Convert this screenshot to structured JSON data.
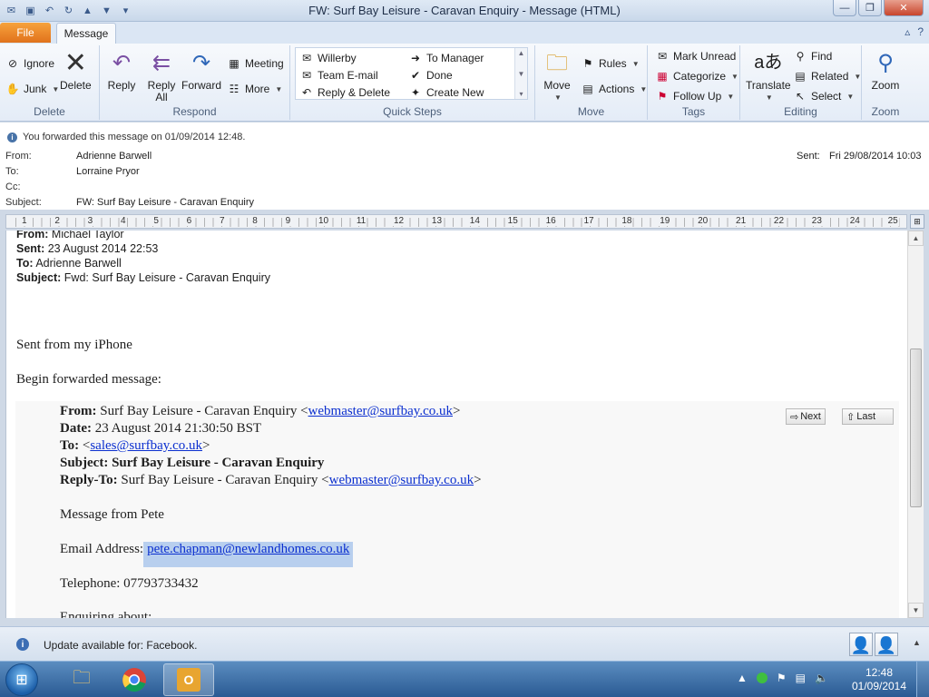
{
  "window": {
    "title": "FW: Surf Bay Leisure - Caravan Enquiry  -  Message (HTML)"
  },
  "tabs": {
    "file": "File",
    "message": "Message"
  },
  "ribbon": {
    "delete_group": {
      "ignore": "Ignore",
      "junk": "Junk",
      "delete": "Delete",
      "label": "Delete"
    },
    "respond_group": {
      "reply": "Reply",
      "reply_all_1": "Reply",
      "reply_all_2": "All",
      "forward": "Forward",
      "meeting": "Meeting",
      "more": "More",
      "label": "Respond"
    },
    "quick_steps": {
      "items": [
        "Willerby",
        "To Manager",
        "Team E-mail",
        "Done",
        "Reply & Delete",
        "Create New"
      ],
      "label": "Quick Steps"
    },
    "move_group": {
      "move": "Move",
      "rules": "Rules",
      "actions": "Actions",
      "label": "Move"
    },
    "tags_group": {
      "mark_unread": "Mark Unread",
      "categorize": "Categorize",
      "follow_up": "Follow Up",
      "label": "Tags"
    },
    "editing_group": {
      "translate": "Translate",
      "find": "Find",
      "related": "Related",
      "select": "Select",
      "label": "Editing"
    },
    "zoom_group": {
      "zoom": "Zoom",
      "label": "Zoom"
    }
  },
  "info": {
    "notice": "You forwarded this message on 01/09/2014 12:48.",
    "from_label": "From:",
    "from": "Adrienne Barwell",
    "to_label": "To:",
    "to": "Lorraine Pryor",
    "cc_label": "Cc:",
    "subject_label": "Subject:",
    "subject": "FW: Surf Bay Leisure - Caravan Enquiry",
    "sent_label": "Sent:",
    "sent": "Fri 29/08/2014 10:03"
  },
  "ruler": {
    "numbers": [
      "1",
      "2",
      "3",
      "4",
      "5",
      "6",
      "7",
      "8",
      "9",
      "10",
      "11",
      "12",
      "13",
      "14",
      "15",
      "16",
      "17",
      "18",
      "19",
      "20",
      "21",
      "22",
      "23",
      "24",
      "25"
    ]
  },
  "body": {
    "fwd_from_label": "From:",
    "fwd_from": "Michael Taylor",
    "fwd_sent_label": "Sent:",
    "fwd_sent": "23 August 2014 22:53",
    "fwd_to_label": "To:",
    "fwd_to": "Adrienne Barwell",
    "fwd_subject_label": "Subject:",
    "fwd_subject": "Fwd: Surf Bay Leisure - Caravan Enquiry",
    "sent_from": "Sent from my iPhone",
    "begin": "Begin forwarded message:",
    "orig_from_label": "From:",
    "orig_from_name": "Surf Bay Leisure - Caravan Enquiry <",
    "orig_from_email": "webmaster@surfbay.co.uk",
    "orig_date_label": "Date:",
    "orig_date": "23 August 2014 21:30:50 BST",
    "orig_to_label": "To:",
    "orig_to_email": "sales@surfbay.co.uk",
    "orig_subject_label": "Subject:",
    "orig_subject": "Surf Bay Leisure - Caravan Enquiry",
    "orig_reply_label": "Reply-To:",
    "orig_reply_name": "Surf Bay Leisure - Caravan Enquiry <",
    "orig_reply_email": "webmaster@surfbay.co.uk",
    "message_from": "Message from Pete",
    "email_label": "Email Address:",
    "email": "pete.chapman@newlandhomes.co.uk",
    "telephone": "Telephone: 07793733432",
    "cut_line": "Enquiring about:",
    "next_btn": "Next",
    "last_btn": "Last"
  },
  "status": {
    "text": "Update available for: Facebook."
  },
  "taskbar": {
    "time": "12:48",
    "date": "01/09/2014"
  },
  "colors": {
    "accent": "#e1721c",
    "link": "#0b2fcf",
    "selection": "#b8cfee",
    "taskbar": "#2a5a93"
  }
}
